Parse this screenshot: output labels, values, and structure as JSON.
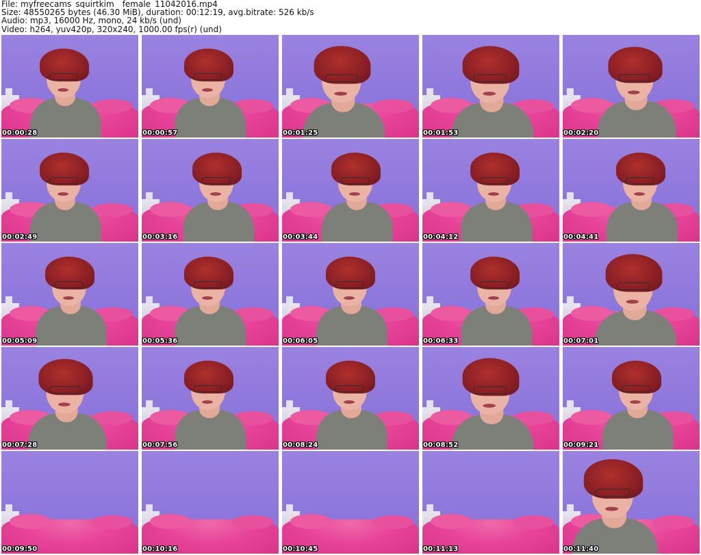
{
  "header": {
    "file_line": "File: myfreecams_squirtkim__female_11042016.mp4",
    "size_line": "Size: 48550265 bytes (46.30 MiB), duration: 00:12:19, avg.bitrate: 526 kb/s",
    "audio_line": "Audio: mp3, 16000 Hz, mono, 24 kb/s (und)",
    "video_line": "Video: h264, yuv420p, 320x240, 1000.00 fps(r) (und)"
  },
  "thumbnails": [
    {
      "timestamp": "00:00:28"
    },
    {
      "timestamp": "00:00:57"
    },
    {
      "timestamp": "00:01:25"
    },
    {
      "timestamp": "00:01:53"
    },
    {
      "timestamp": "00:02:20"
    },
    {
      "timestamp": "00:02:49"
    },
    {
      "timestamp": "00:03:16"
    },
    {
      "timestamp": "00:03:44"
    },
    {
      "timestamp": "00:04:12"
    },
    {
      "timestamp": "00:04:41"
    },
    {
      "timestamp": "00:05:09"
    },
    {
      "timestamp": "00:05:36"
    },
    {
      "timestamp": "00:06:05"
    },
    {
      "timestamp": "00:06:33"
    },
    {
      "timestamp": "00:07:01"
    },
    {
      "timestamp": "00:07:28"
    },
    {
      "timestamp": "00:07:56"
    },
    {
      "timestamp": "00:08:24"
    },
    {
      "timestamp": "00:08:52"
    },
    {
      "timestamp": "00:09:21"
    },
    {
      "timestamp": "00:09:50"
    },
    {
      "timestamp": "00:10:16"
    },
    {
      "timestamp": "00:10:45"
    },
    {
      "timestamp": "00:11:13"
    },
    {
      "timestamp": "00:11:40"
    }
  ],
  "colors": {
    "wall": "#9a82e0",
    "couch": "#e8459a",
    "hair": "#8a1f24",
    "shirt": "#7d7f79"
  }
}
